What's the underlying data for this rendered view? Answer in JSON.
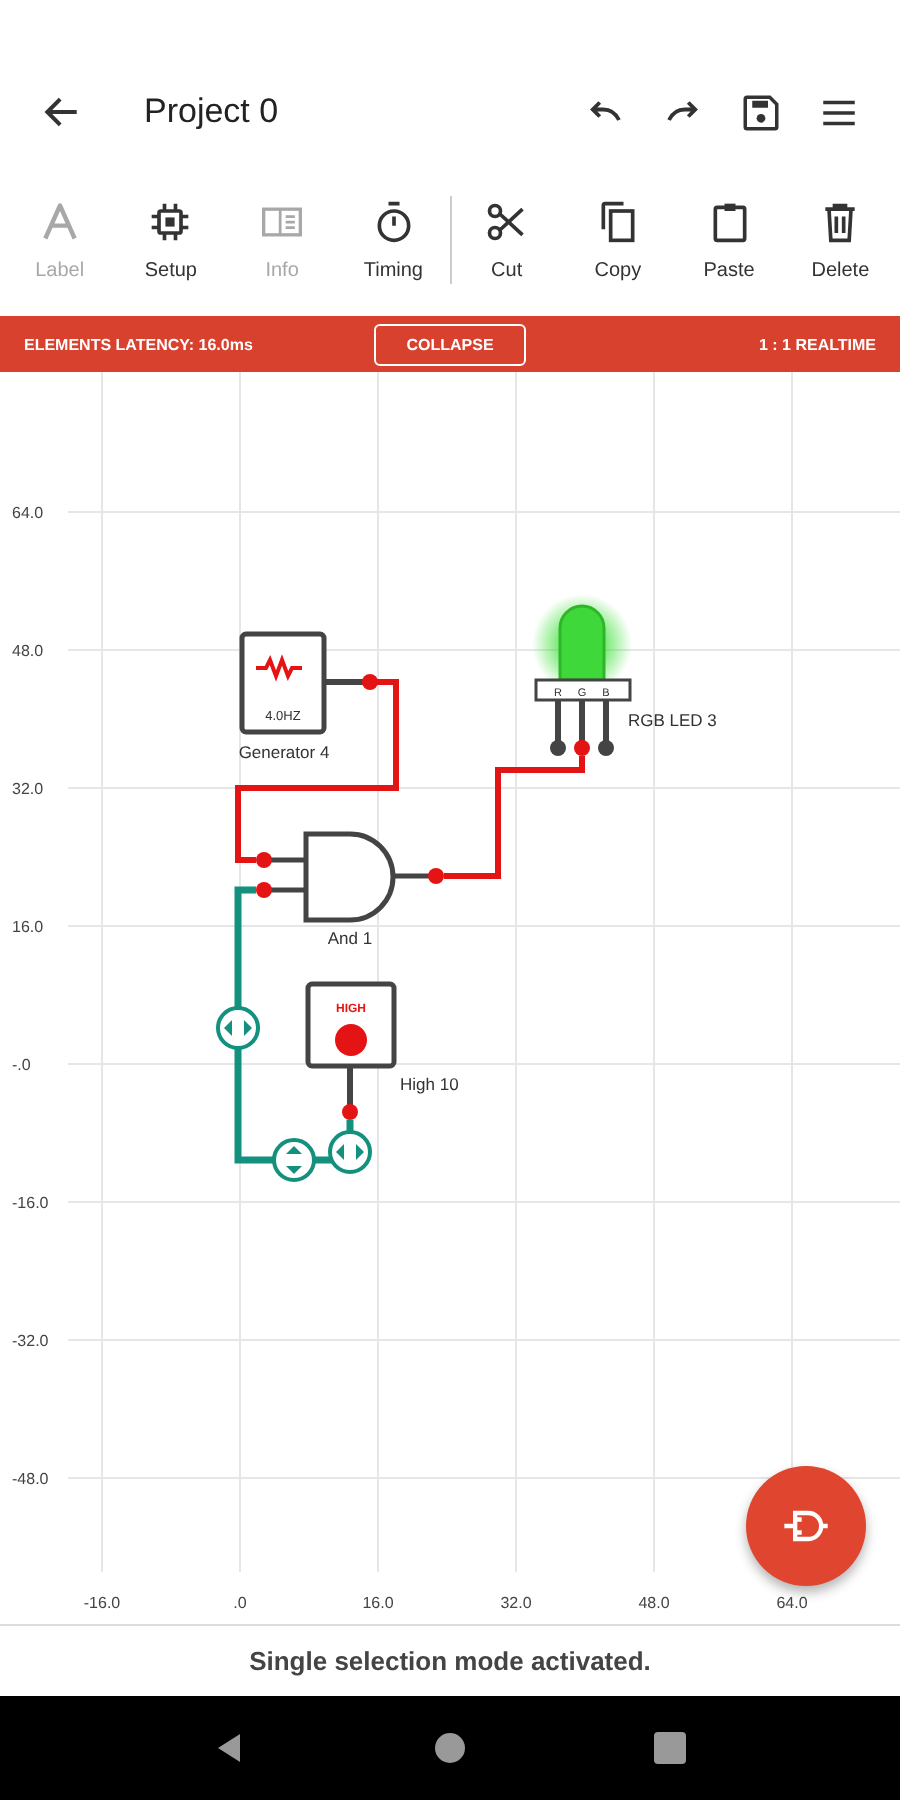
{
  "header": {
    "title": "Project 0"
  },
  "toolbar": [
    {
      "label": "Label",
      "disabled": true
    },
    {
      "label": "Setup",
      "disabled": false
    },
    {
      "label": "Info",
      "disabled": true
    },
    {
      "label": "Timing",
      "disabled": false
    },
    {
      "label": "Cut",
      "disabled": false
    },
    {
      "label": "Copy",
      "disabled": false
    },
    {
      "label": "Paste",
      "disabled": false
    },
    {
      "label": "Delete",
      "disabled": false
    }
  ],
  "latency_bar": {
    "latency": "ELEMENTS LATENCY: 16.0ms",
    "button": "COLLAPSE",
    "speed": "1 : 1 REALTIME"
  },
  "canvas": {
    "y_axis": [
      "64.0",
      "48.0",
      "32.0",
      "16.0",
      "-.0",
      "-16.0",
      "-32.0",
      "-48.0"
    ],
    "x_axis": [
      "-16.0",
      ".0",
      "16.0",
      "32.0",
      "48.0",
      "64.0"
    ],
    "components": [
      {
        "kind": "generator",
        "name": "Generator 4",
        "display": "4.0HZ"
      },
      {
        "kind": "and",
        "name": "And 1"
      },
      {
        "kind": "led",
        "name": "RGB LED 3",
        "pins": [
          "R",
          "G",
          "B"
        ],
        "lit": true
      },
      {
        "kind": "high",
        "name": "High 10",
        "display": "HIGH"
      }
    ]
  },
  "status": "Single selection mode activated."
}
